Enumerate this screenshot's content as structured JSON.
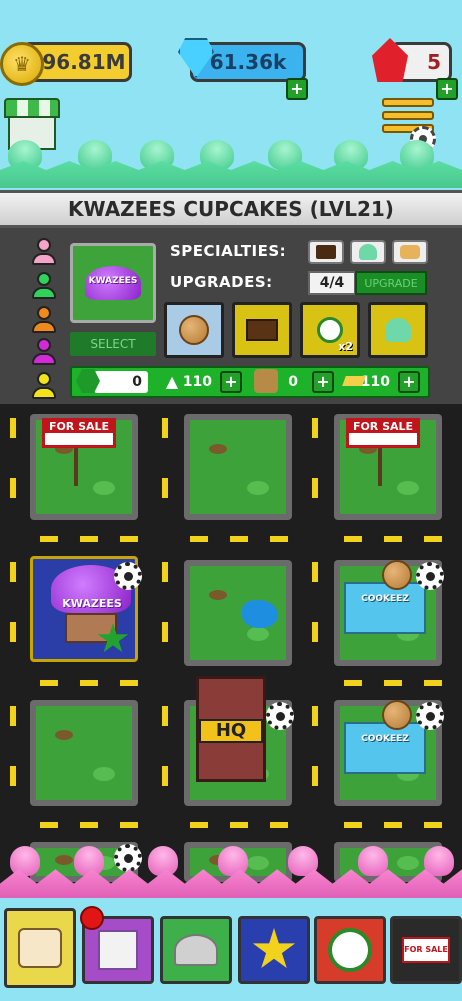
{
  "currency": {
    "coins": "296.81M",
    "gems": "61.36k",
    "tickets": "5"
  },
  "icons": {
    "coin": "coin-icon",
    "gem": "gem-icon",
    "ticket": "red-gem-icon",
    "shop": "shop-icon",
    "menu": "menu-icon",
    "settings": "gear-icon"
  },
  "store": {
    "title": "KWAZEES CUPCAKES (LVL21)",
    "thumb_label": "KWAZEES",
    "select_label": "SELECT",
    "specialties_label": "SPECIALTIES:",
    "upgrades_label": "UPGRADES:",
    "upgrade_count": "4/4",
    "upgrade_button": "UPGRADE",
    "boost_label": "x2"
  },
  "resources": {
    "gem_stock": "0",
    "sugar": "110",
    "flour": "0",
    "butter": "110"
  },
  "map": {
    "for_sale_label": "FOR SALE",
    "kwazees_label": "KWAZEES",
    "cookeez_label": "COOKEEZ",
    "hq_label": "HQ"
  },
  "nav": {
    "for_sale_label": "FOR SALE"
  },
  "colors": {
    "sky": "#8fe3f2",
    "gold": "#f3cc2e",
    "gem_blue": "#3ab3ef",
    "accent_green": "#1eb12a",
    "frosting_mint": "#5ce0a4",
    "frosting_pink": "#ff8ed6",
    "for_sale_red": "#c0151a"
  }
}
